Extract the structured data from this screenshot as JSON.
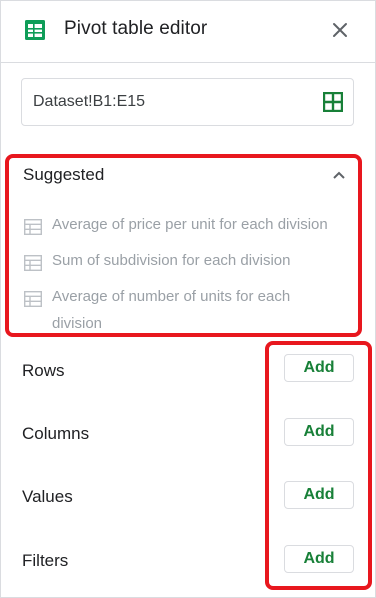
{
  "header": {
    "title": "Pivot table editor",
    "app_icon": "sheets-icon",
    "close_icon": "close-icon"
  },
  "range": {
    "value": "Dataset!B1:E15",
    "icon": "grid-select-icon"
  },
  "suggested": {
    "title": "Suggested",
    "items": [
      {
        "label": "Average of price per unit for each division"
      },
      {
        "label": "Sum of subdivision for each division"
      },
      {
        "label": "Average of number of units for each division"
      }
    ]
  },
  "sections": [
    {
      "label": "Rows",
      "button": "Add"
    },
    {
      "label": "Columns",
      "button": "Add"
    },
    {
      "label": "Values",
      "button": "Add"
    },
    {
      "label": "Filters",
      "button": "Add"
    }
  ],
  "colors": {
    "accent_green": "#188038",
    "sheets_green": "#0f9d58",
    "highlight_red": "#e8171e",
    "muted_text": "#9aa0a6"
  }
}
